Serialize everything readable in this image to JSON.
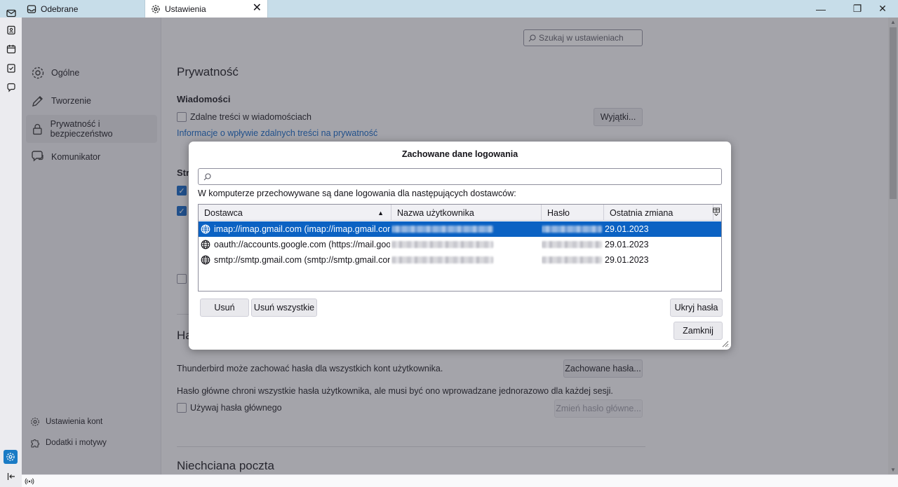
{
  "tabs": [
    {
      "label": "Odebrane",
      "icon": "inbox-icon"
    },
    {
      "label": "Ustawienia",
      "icon": "gear-icon",
      "active": true
    }
  ],
  "window_controls": {
    "minimize": "—",
    "maximize": "❐",
    "close": "✕"
  },
  "spaces": [
    "mail-icon",
    "address-book-icon",
    "calendar-icon",
    "tasks-icon",
    "chat-icon",
    "settings-icon",
    "collapse-icon"
  ],
  "nav": {
    "items": [
      {
        "label": "Ogólne",
        "icon": "gear-icon"
      },
      {
        "label": "Tworzenie",
        "icon": "pencil-icon"
      },
      {
        "label": "Prywatność i bezpieczeństwo",
        "icon": "lock-icon",
        "selected": true
      },
      {
        "label": "Komunikator",
        "icon": "chat-icon"
      }
    ],
    "bottom": [
      {
        "label": "Ustawienia kont",
        "icon": "account-gear-icon"
      },
      {
        "label": "Dodatki i motywy",
        "icon": "puzzle-icon"
      }
    ]
  },
  "content": {
    "search_placeholder": "Szukaj w ustawieniach",
    "section_title": "Prywatność",
    "messages_heading": "Wiadomości",
    "remote_content_label": "Zdalne treści w wiadomościach",
    "exceptions_button": "Wyjątki...",
    "privacy_link": "Informacje o wpływie zdalnych treści na prywatność",
    "truncated_heading_1": "Str",
    "truncated_heading_2": "Ha",
    "passwords_text": "Thunderbird może zachować hasła dla wszystkich kont użytkownika.",
    "saved_passwords_button": "Zachowane hasła...",
    "master_text": "Hasło główne chroni wszystkie hasła użytkownika, ale musi być ono wprowadzane jednorazowo dla każdej sesji.",
    "master_checkbox_label": "Używaj hasła głównego",
    "change_master_button": "Zmień hasło główne...",
    "junk_title": "Niechciana poczta"
  },
  "dialog": {
    "title": "Zachowane dane logowania",
    "search_value": "",
    "description": "W komputerze przechowywane są dane logowania dla następujących dostawców:",
    "columns": [
      "Dostawca",
      "Nazwa użytkownika",
      "Hasło",
      "Ostatnia zmiana"
    ],
    "sort_indicator": "▲",
    "rows": [
      {
        "provider": "imap://imap.gmail.com (imap://imap.gmail.com)",
        "changed": "29.01.2023",
        "selected": true
      },
      {
        "provider": "oauth://accounts.google.com (https://mail.google...",
        "changed": "29.01.2023"
      },
      {
        "provider": "smtp://smtp.gmail.com (smtp://smtp.gmail.com)",
        "changed": "29.01.2023"
      }
    ],
    "remove_button": "Usuń",
    "remove_all_button": "Usuń wszystkie",
    "hide_passwords_button": "Ukryj hasła",
    "close_button": "Zamknij"
  }
}
